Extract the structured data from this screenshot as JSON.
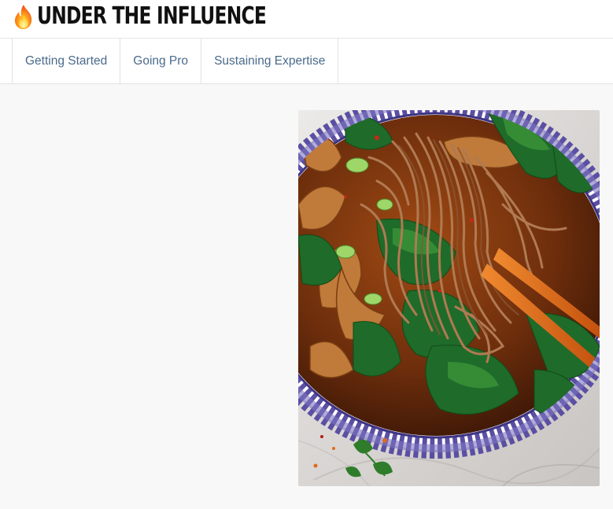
{
  "site": {
    "title": "UNDER THE INFLUENCE",
    "logo_icon": "flame-icon"
  },
  "nav": {
    "items": [
      {
        "label": "Getting Started"
      },
      {
        "label": "Going Pro"
      },
      {
        "label": "Sustaining Expertise"
      }
    ]
  },
  "main": {
    "image": {
      "subject": "soba-noodle-soup-photo",
      "colors": {
        "broth": "#7a3a12",
        "noodles": "#b07a52",
        "greens": "#1f6b2a",
        "bowl_pattern": "#5b4fa3",
        "marble": "#e6e4e2",
        "chopsticks": "#d9661e"
      }
    }
  },
  "colors": {
    "background": "#f8f8f8",
    "header_bg": "#ffffff",
    "nav_text": "#4a6a8a",
    "border": "#e2e2e2",
    "title_text": "#111111"
  }
}
